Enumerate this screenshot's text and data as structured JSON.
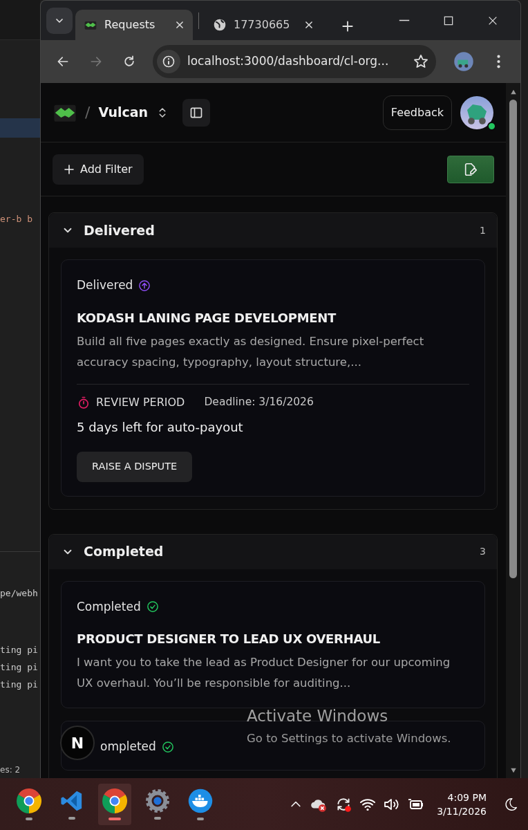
{
  "editor": {
    "lines": [
      {
        "text": "er-b b",
        "kind": "code"
      },
      {
        "text": "pe/webh",
        "kind": "output"
      },
      {
        "text": "ting pi",
        "kind": "output"
      },
      {
        "text": "ting pi",
        "kind": "output"
      },
      {
        "text": "ting pi",
        "kind": "output"
      },
      {
        "text": "es: 2",
        "kind": "status"
      }
    ]
  },
  "browser": {
    "tabs": [
      {
        "title": "Requests",
        "kind": "app",
        "selected": true
      },
      {
        "title": "17730665",
        "kind": "globe",
        "selected": false
      }
    ],
    "address": "localhost:3000/dashboard/cl-org..."
  },
  "header": {
    "separator": "/",
    "workspace": "Vulcan",
    "feedback": "Feedback",
    "online": true
  },
  "toolbar": {
    "add_filter": "Add Filter"
  },
  "sections": [
    {
      "title": "Delivered",
      "count": "1",
      "expanded": true,
      "cards": [
        {
          "kind": "delivered",
          "status": "Delivered",
          "title": "KODASH LANING PAGE DEVELOPMENT",
          "description": "Build all five pages exactly as designed. Ensure pixel-perfect accuracy spacing, typography, layout structure,...",
          "review": {
            "label": "REVIEW PERIOD",
            "deadline": "Deadline: 3/16/2026",
            "remaining": "5 days left for auto-payout",
            "action": "RAISE A DISPUTE"
          }
        }
      ]
    },
    {
      "title": "Completed",
      "count": "3",
      "expanded": true,
      "cards": [
        {
          "kind": "completed",
          "status": "Completed",
          "title": "PRODUCT DESIGNER TO LEAD UX OVERHAUL",
          "description": "I want you to take the lead as Product Designer for our upcoming UX overhaul. You’ll be responsible for auditing..."
        },
        {
          "kind": "completed",
          "status": "ompleted"
        }
      ]
    }
  ],
  "dev_badge": "N",
  "activation": {
    "title": "Activate Windows",
    "subtitle": "Go to Settings to activate Windows."
  },
  "taskbar": {
    "apps": [
      {
        "kind": "chrome",
        "running": true,
        "selected": false
      },
      {
        "kind": "vscode",
        "running": true,
        "selected": false
      },
      {
        "kind": "chrome",
        "running": true,
        "selected": true
      },
      {
        "kind": "settings",
        "running": true,
        "selected": false
      },
      {
        "kind": "docker",
        "running": true,
        "selected": false
      }
    ],
    "time": "4:09 PM",
    "date": "3/11/2026"
  }
}
